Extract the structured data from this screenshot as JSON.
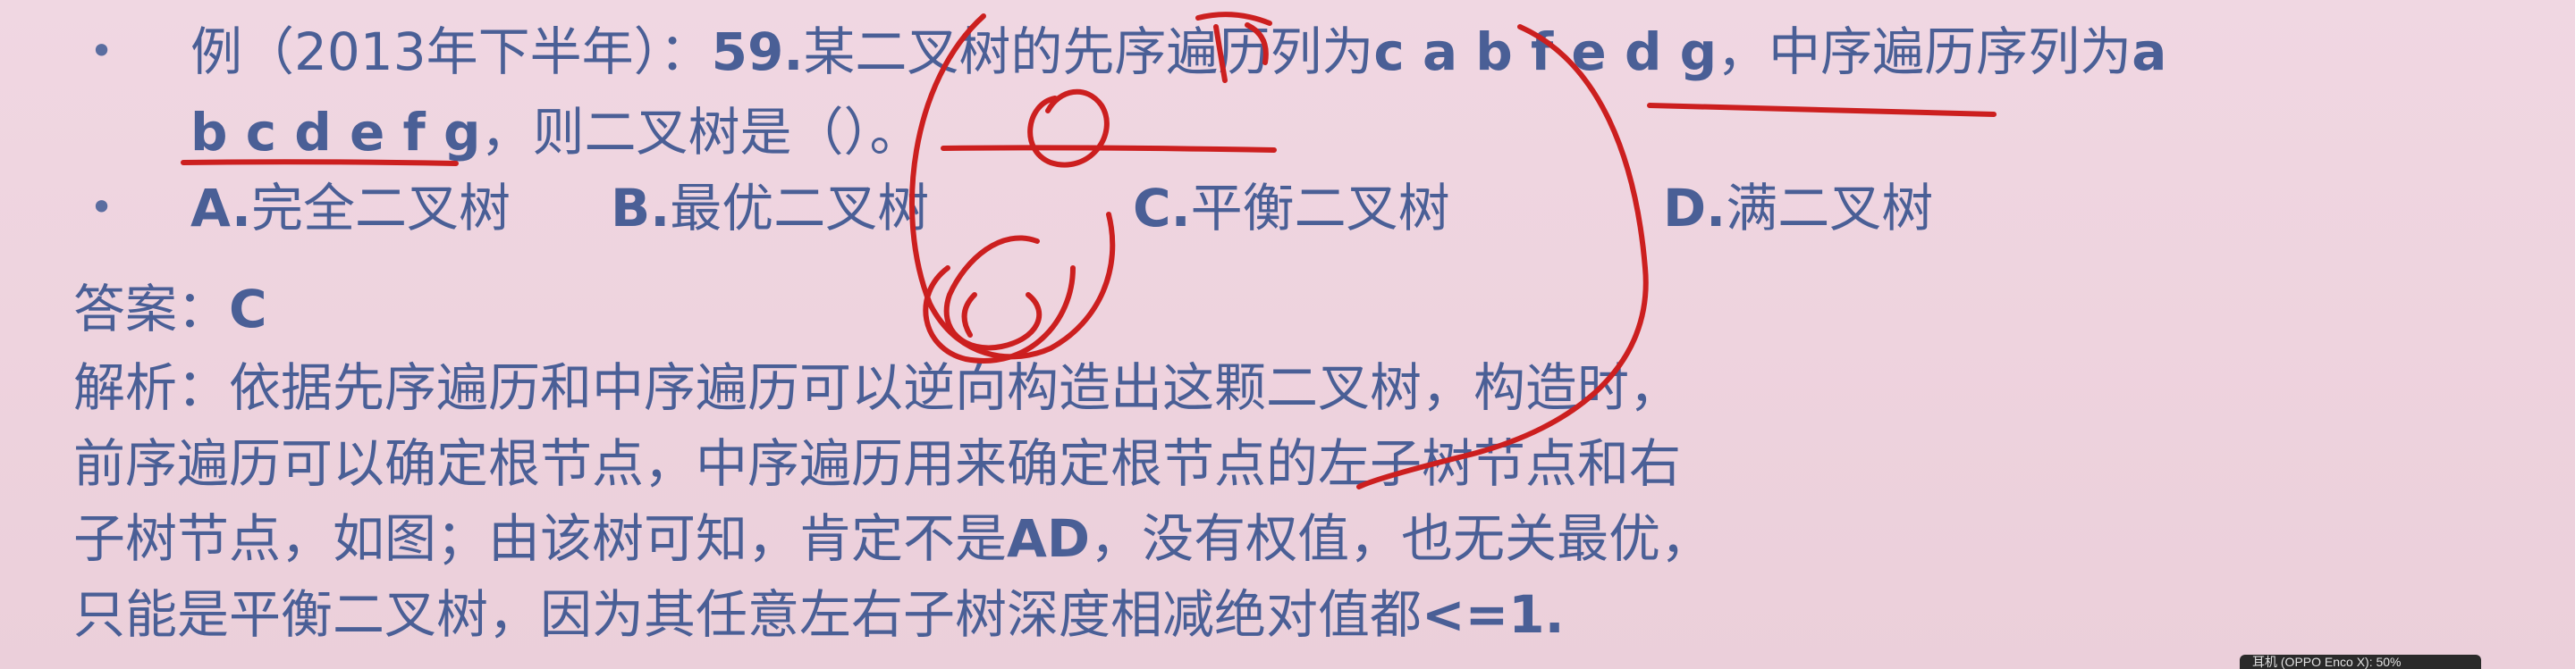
{
  "question": {
    "bullet": "•",
    "prefix": "例（2013年下半年）：",
    "number": "59.",
    "stem_a": "某二叉树的先序遍历列为",
    "preorder": "c a b f e d g",
    "stem_b": "，中序遍历序列为",
    "inorder_first": "a",
    "inorder_rest": "b c d e f g",
    "stem_c": "，则二叉树是（）。"
  },
  "options": {
    "bullet": "•",
    "items": [
      {
        "letter": "A.",
        "text": "完全二叉树"
      },
      {
        "letter": "B.",
        "text": "最优二叉树"
      },
      {
        "letter": "C.",
        "text": "平衡二叉树"
      },
      {
        "letter": "D.",
        "text": "满二叉树"
      }
    ]
  },
  "answer": {
    "label": "答案：",
    "value": "C"
  },
  "explanation": {
    "line1": "解析：依据先序遍历和中序遍历可以逆向构造出这颗二叉树，构造时，",
    "line2": "前序遍历可以确定根节点，中序遍历用来确定根节点的左子树节点和右",
    "line3_a": "子树节点，如图；由该树可知，肯定不是",
    "line3_b": "AD",
    "line3_c": "，没有权值，也无关最优，",
    "line4_a": "只能是平衡二叉树，因为其任意左右子树深度相减绝对值都",
    "line4_b": "<=1",
    "line4_c": "."
  },
  "status_bar": {
    "text": "耳机 (OPPO Enco X): 50%"
  },
  "colors": {
    "text": "#4a5f96",
    "annotation": "#cc1f1f",
    "background": "#eed3de"
  }
}
